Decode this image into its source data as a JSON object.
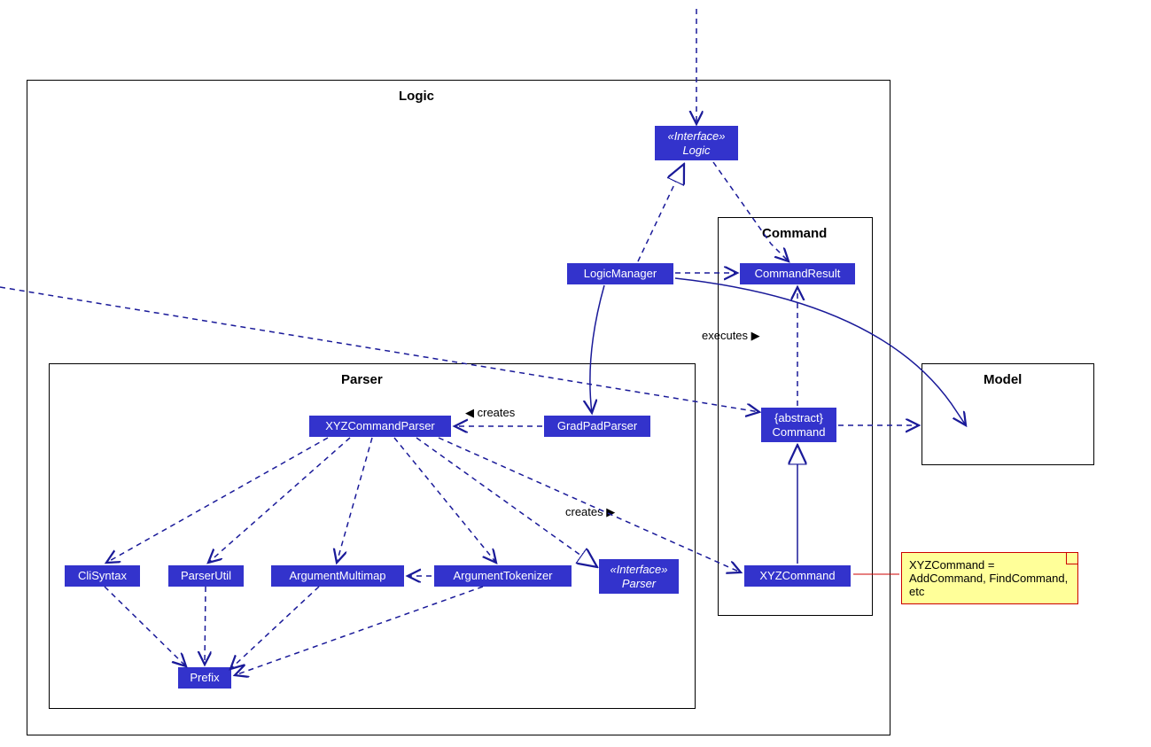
{
  "packages": {
    "logic_title": "Logic",
    "parser_title": "Parser",
    "command_title": "Command",
    "model_title": "Model"
  },
  "nodes": {
    "logic_if_stereo": "«Interface»",
    "logic_if_name": "Logic",
    "logic_manager": "LogicManager",
    "gradpad_parser": "GradPadParser",
    "xyz_cmd_parser": "XYZCommandParser",
    "parser_if_stereo": "«Interface»",
    "parser_if_name": "Parser",
    "cli_syntax": "CliSyntax",
    "parser_util": "ParserUtil",
    "arg_multimap": "ArgumentMultimap",
    "arg_tokenizer": "ArgumentTokenizer",
    "prefix": "Prefix",
    "command_result": "CommandResult",
    "command_stereo": "{abstract}",
    "command_name": "Command",
    "xyz_command": "XYZCommand"
  },
  "labels": {
    "creates_left": "◀ creates",
    "creates_right": "creates ▶",
    "executes": "executes ▶"
  },
  "note": {
    "text": "XYZCommand = AddCommand, FindCommand, etc"
  },
  "colors": {
    "node_fill": "#3333cc",
    "edge": "#1a1a99",
    "note_fill": "#ffff99",
    "note_border": "#cc0000"
  },
  "chart_data": {
    "type": "uml-class-diagram",
    "packages": [
      {
        "name": "Logic",
        "contains": [
          "«Interface» Logic",
          "LogicManager",
          "Parser",
          "Command"
        ]
      },
      {
        "name": "Parser",
        "contains": [
          "XYZCommandParser",
          "GradPadParser",
          "«Interface» Parser",
          "CliSyntax",
          "ParserUtil",
          "ArgumentMultimap",
          "ArgumentTokenizer",
          "Prefix"
        ]
      },
      {
        "name": "Command",
        "contains": [
          "CommandResult",
          "{abstract} Command",
          "XYZCommand"
        ]
      },
      {
        "name": "Model",
        "contains": []
      }
    ],
    "classes": [
      {
        "name": "Logic",
        "stereotype": "Interface"
      },
      {
        "name": "LogicManager"
      },
      {
        "name": "GradPadParser"
      },
      {
        "name": "XYZCommandParser"
      },
      {
        "name": "Parser",
        "stereotype": "Interface"
      },
      {
        "name": "CliSyntax"
      },
      {
        "name": "ParserUtil"
      },
      {
        "name": "ArgumentMultimap"
      },
      {
        "name": "ArgumentTokenizer"
      },
      {
        "name": "Prefix"
      },
      {
        "name": "CommandResult"
      },
      {
        "name": "Command",
        "stereotype": "abstract"
      },
      {
        "name": "XYZCommand"
      }
    ],
    "relationships": [
      {
        "from": "(external)",
        "to": "Logic",
        "type": "dependency"
      },
      {
        "from": "LogicManager",
        "to": "Logic",
        "type": "realization"
      },
      {
        "from": "Logic",
        "to": "CommandResult",
        "type": "dependency"
      },
      {
        "from": "LogicManager",
        "to": "CommandResult",
        "type": "dependency"
      },
      {
        "from": "LogicManager",
        "to": "GradPadParser",
        "type": "association"
      },
      {
        "from": "LogicManager",
        "to": "Command",
        "type": "dependency",
        "label": "executes"
      },
      {
        "from": "LogicManager",
        "to": "Model",
        "type": "association"
      },
      {
        "from": "GradPadParser",
        "to": "XYZCommandParser",
        "type": "dependency",
        "label": "creates"
      },
      {
        "from": "XYZCommandParser",
        "to": "Parser",
        "type": "realization"
      },
      {
        "from": "XYZCommandParser",
        "to": "CliSyntax",
        "type": "dependency"
      },
      {
        "from": "XYZCommandParser",
        "to": "ParserUtil",
        "type": "dependency"
      },
      {
        "from": "XYZCommandParser",
        "to": "ArgumentMultimap",
        "type": "dependency"
      },
      {
        "from": "XYZCommandParser",
        "to": "ArgumentTokenizer",
        "type": "dependency"
      },
      {
        "from": "XYZCommandParser",
        "to": "XYZCommand",
        "type": "dependency",
        "label": "creates"
      },
      {
        "from": "ArgumentTokenizer",
        "to": "ArgumentMultimap",
        "type": "dependency"
      },
      {
        "from": "CliSyntax",
        "to": "Prefix",
        "type": "dependency"
      },
      {
        "from": "ParserUtil",
        "to": "Prefix",
        "type": "dependency"
      },
      {
        "from": "ArgumentMultimap",
        "to": "Prefix",
        "type": "dependency"
      },
      {
        "from": "ArgumentTokenizer",
        "to": "Prefix",
        "type": "dependency"
      },
      {
        "from": "XYZCommand",
        "to": "Command",
        "type": "generalization"
      },
      {
        "from": "Command",
        "to": "CommandResult",
        "type": "dependency"
      },
      {
        "from": "Command",
        "to": "Model",
        "type": "dependency"
      }
    ],
    "notes": [
      {
        "text": "XYZCommand = AddCommand, FindCommand, etc",
        "attached_to": "XYZCommand"
      }
    ]
  }
}
